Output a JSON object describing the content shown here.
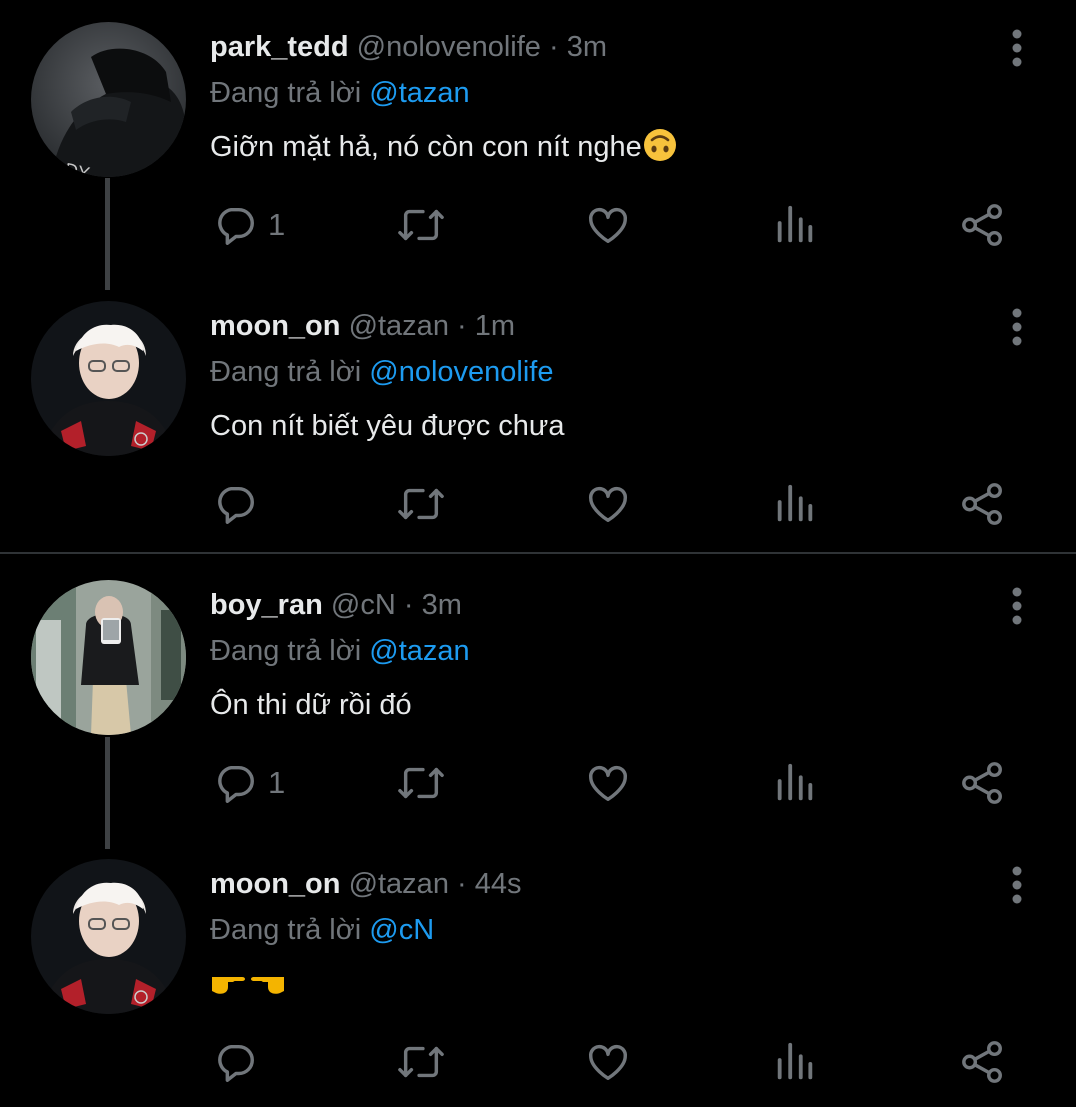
{
  "theme": {
    "background": "#000000",
    "text_primary": "#e7e9ea",
    "text_secondary": "#71767b",
    "link": "#1d9bf0",
    "divider": "#2f3336",
    "thread_line": "#3e4144"
  },
  "tweets": [
    {
      "name": "park_tedd",
      "handle": "@nolovenolife",
      "dot": "·",
      "time": "3m",
      "reply_prefix": "Đang trả lời",
      "reply_to": "@tazan",
      "text": "Giỡn mặt hả, nó còn con nít nghe",
      "text_emoji": "upside-down-face-emoji",
      "reply_count": "1",
      "avatar_icon": "avatar-dark-hoodie",
      "icons": [
        "reply-icon",
        "retweet-icon",
        "like-icon",
        "views-icon",
        "share-icon",
        "more-icon"
      ]
    },
    {
      "name": "moon_on",
      "handle": "@tazan",
      "dot": "·",
      "time": "1m",
      "reply_prefix": "Đang trả lời",
      "reply_to": "@nolovenolife",
      "text": "Con nít biết yêu được chưa",
      "reply_count": "",
      "avatar_icon": "avatar-blond-hair",
      "icons": [
        "reply-icon",
        "retweet-icon",
        "like-icon",
        "views-icon",
        "share-icon",
        "more-icon"
      ]
    },
    {
      "name": "boy_ran",
      "handle": "@cN",
      "dot": "·",
      "time": "3m",
      "reply_prefix": "Đang trả lời",
      "reply_to": "@tazan",
      "text": "Ôn thi dữ rồi đó",
      "reply_count": "1",
      "avatar_icon": "avatar-mirror-selfie",
      "icons": [
        "reply-icon",
        "retweet-icon",
        "like-icon",
        "views-icon",
        "share-icon",
        "more-icon"
      ]
    },
    {
      "name": "moon_on",
      "handle": "@tazan",
      "dot": "·",
      "time": "44s",
      "reply_prefix": "Đang trả lời",
      "reply_to": "@cN",
      "text": "",
      "text_emoji": "pointing-hands-emoji",
      "reply_count": "",
      "avatar_icon": "avatar-blond-hair",
      "icons": [
        "reply-icon",
        "retweet-icon",
        "like-icon",
        "views-icon",
        "share-icon",
        "more-icon"
      ]
    }
  ]
}
